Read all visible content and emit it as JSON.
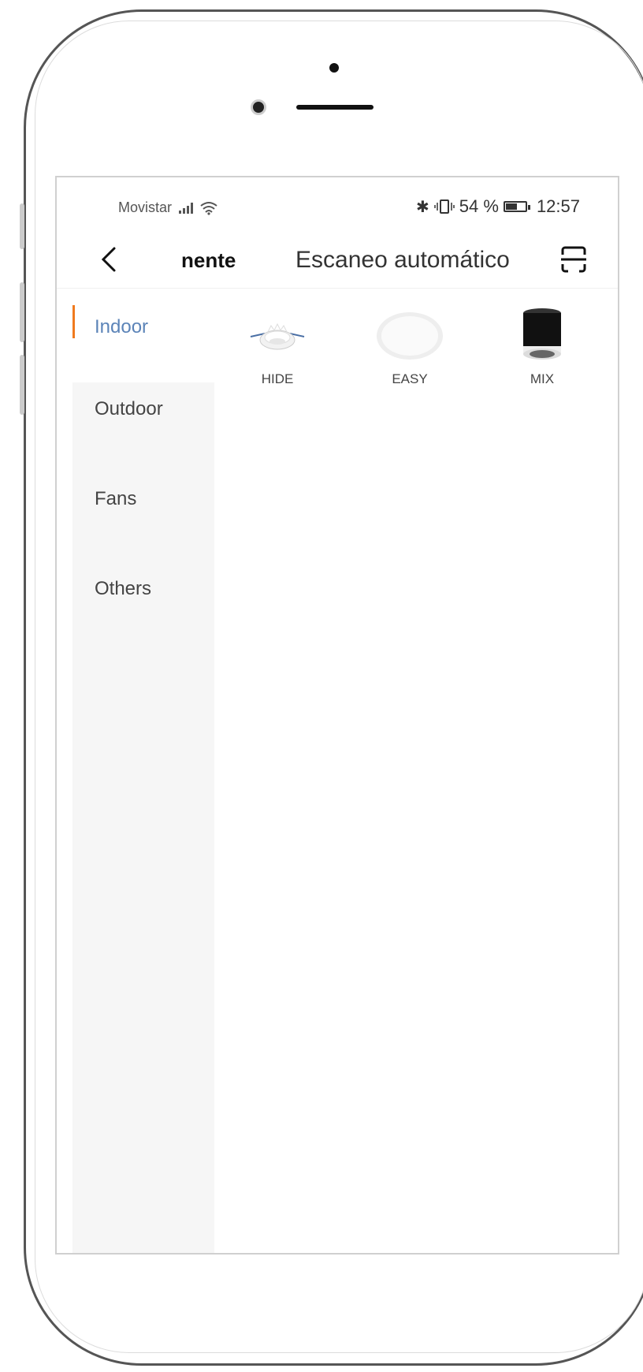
{
  "status": {
    "carrier": "Movistar",
    "battery": "54 %",
    "time": "12:57"
  },
  "nav": {
    "partial_title": "nente",
    "title": "Escaneo automático"
  },
  "sidebar": {
    "items": [
      {
        "label": "Indoor",
        "active": true
      },
      {
        "label": "Outdoor",
        "active": false
      },
      {
        "label": "Fans",
        "active": false
      },
      {
        "label": "Others",
        "active": false
      }
    ]
  },
  "products": [
    {
      "name": "HIDE",
      "icon": "recessed-downlight-icon"
    },
    {
      "name": "EASY",
      "icon": "round-panel-light-icon"
    },
    {
      "name": "MIX",
      "icon": "cylinder-spotlight-icon"
    }
  ],
  "colors": {
    "accent": "#f07a1e",
    "active_text": "#5c84b8",
    "sidebar_bg": "#f6f6f6"
  }
}
